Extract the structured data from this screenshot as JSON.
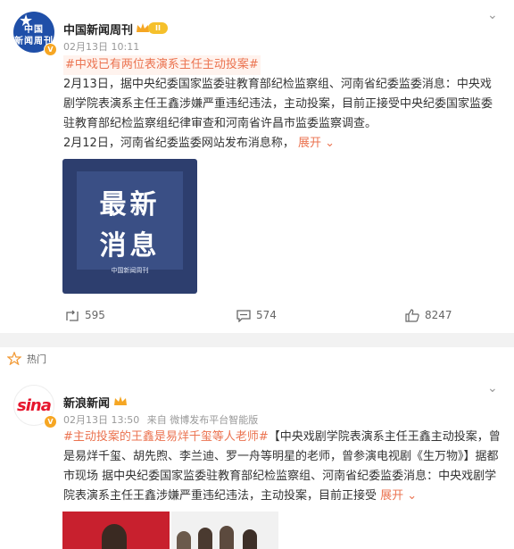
{
  "post1": {
    "author": "中国新闻周刊",
    "avatar_text_top": "中国",
    "avatar_text_bottom": "新闻周刊",
    "level": "II",
    "time": "02月13日 10:11",
    "hashtag": "#中戏已有两位表演系主任主动投案#",
    "body": "2月13日，据中央纪委国家监委驻教育部纪检监察组、河南省纪委监委消息：中央戏剧学院表演系主任王鑫涉嫌严重违纪违法，主动投案，目前正接受中央纪委国家监委驻教育部纪检监察组纪律审查和河南省许昌市监委监察调查。",
    "body2": "2月12日，河南省纪委监委网站发布消息称，",
    "expand": "展开",
    "image": {
      "line1": "最新",
      "line2": "消息",
      "caption": "中国新闻周刊"
    },
    "actions": {
      "repost": "595",
      "comment": "574",
      "like": "8247"
    }
  },
  "hot": {
    "label": "热门"
  },
  "post2": {
    "author": "新浪新闻",
    "avatar_text": "sina",
    "time": "02月13日 13:50",
    "source": "来自 微博发布平台智能版",
    "hashtag": "#主动投案的王鑫是易烊千玺等人老师#",
    "body": "【中央戏剧学院表演系主任王鑫主动投案，曾是易烊千玺、胡先煦、李兰迪、罗一舟等明星的老师，曾参演电视剧《生万物》】据都市现场 据中央纪委国家监委驻教育部纪检监察组、河南省纪委监委消息：中央戏剧学院表演系主任王鑫涉嫌严重违纪违法，主动投案，目前正接受",
    "expand": "展开"
  },
  "colors": {
    "accent": "#eb7350",
    "brand_blue": "#1f4fa8",
    "sina_red": "#e6162d",
    "gold": "#f5c02b"
  }
}
